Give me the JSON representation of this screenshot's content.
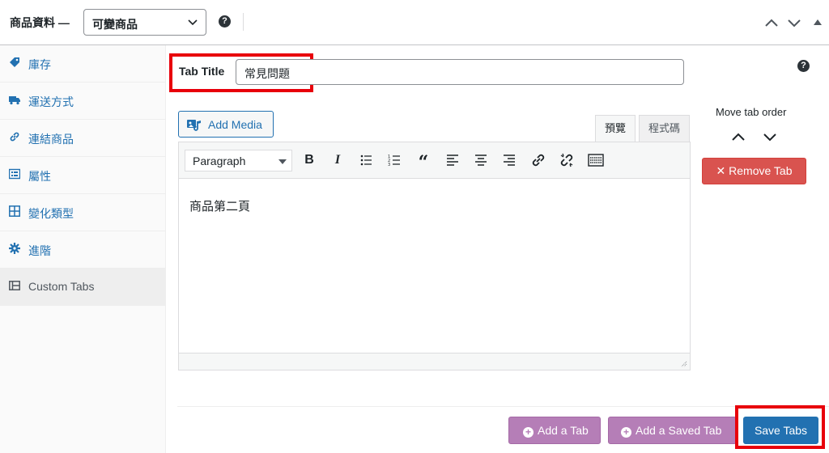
{
  "header": {
    "title": "商品資料 —",
    "product_type": "可變商品"
  },
  "sidebar": {
    "items": [
      {
        "label": "庫存",
        "icon": "tag-icon"
      },
      {
        "label": "運送方式",
        "icon": "truck-icon"
      },
      {
        "label": "連結商品",
        "icon": "link-icon"
      },
      {
        "label": "屬性",
        "icon": "list-icon"
      },
      {
        "label": "變化類型",
        "icon": "grid-icon"
      },
      {
        "label": "進階",
        "icon": "gear-icon"
      },
      {
        "label": "Custom Tabs",
        "icon": "tabs-icon"
      }
    ]
  },
  "tab_title": {
    "label": "Tab Title",
    "value": "常見問題"
  },
  "editor": {
    "add_media": "Add Media",
    "tab_visual": "預覽",
    "tab_text": "程式碼",
    "format": "Paragraph",
    "content": "商品第二頁"
  },
  "move": {
    "label": "Move tab order"
  },
  "buttons": {
    "remove": "✕ Remove Tab",
    "add_tab": "Add a Tab",
    "add_saved": "Add a Saved Tab",
    "save": "Save Tabs"
  },
  "colors": {
    "accent": "#2271b1",
    "danger": "#d9534f",
    "purple": "#b57eb7",
    "highlight": "#e8000b"
  }
}
